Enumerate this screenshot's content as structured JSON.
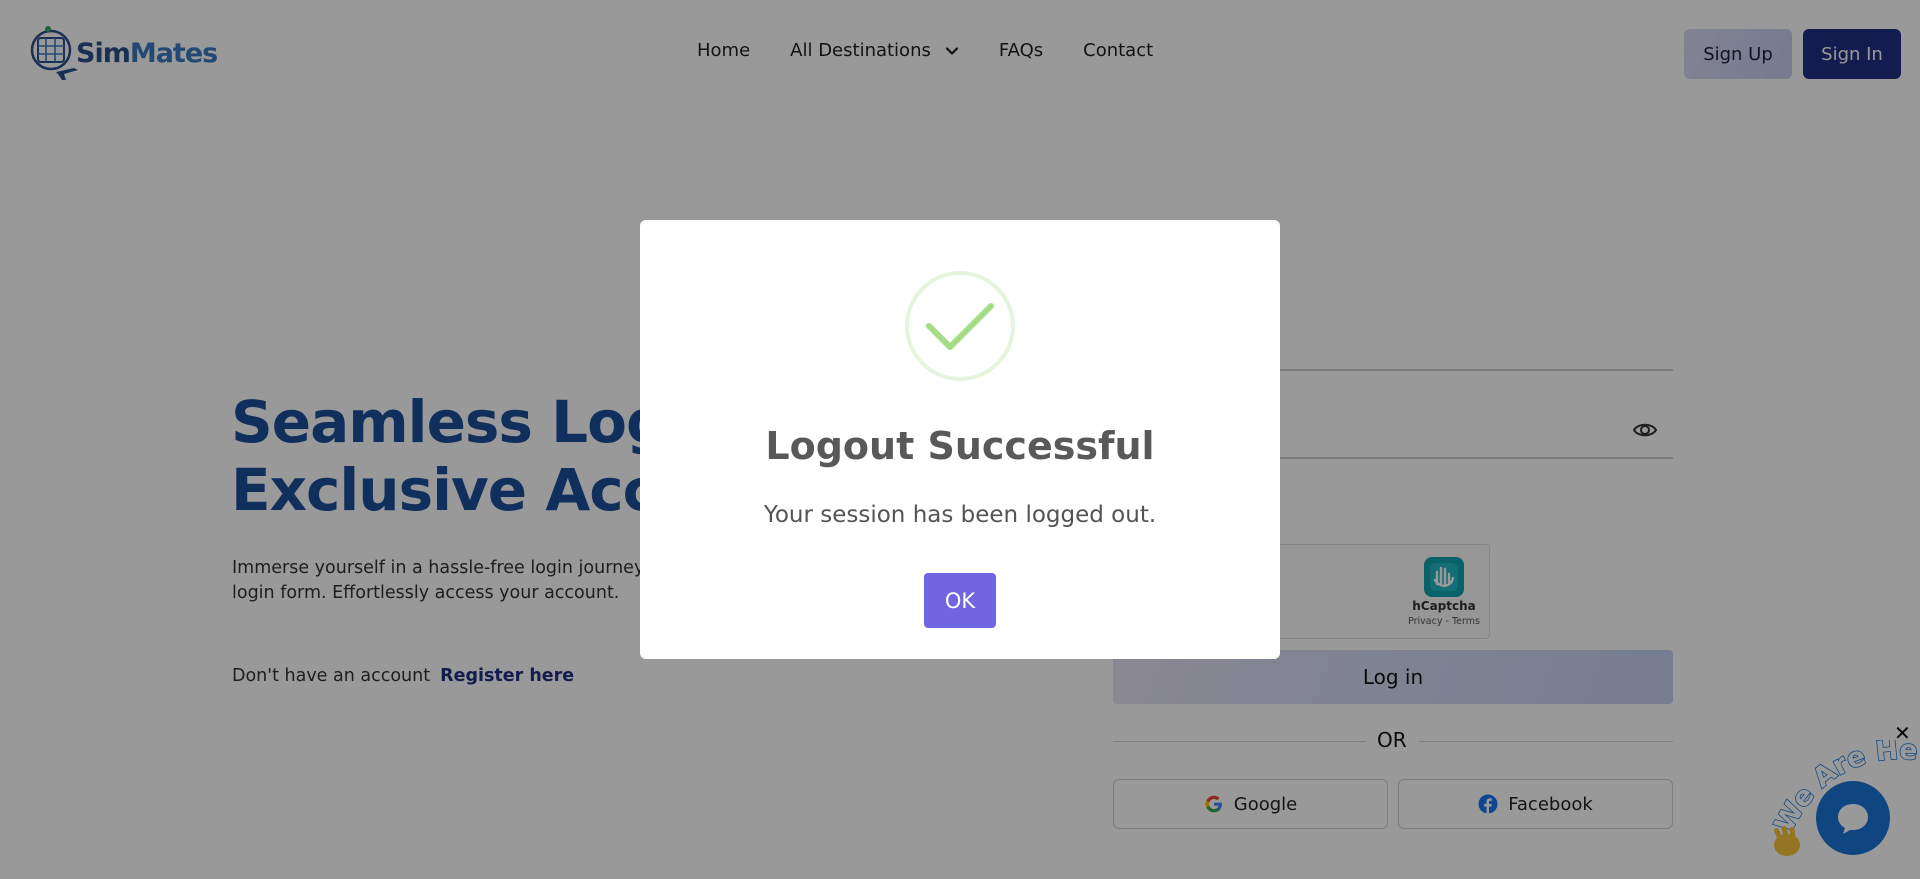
{
  "brand": {
    "name_part1": "Sim",
    "name_part2": "Mates"
  },
  "nav": {
    "items": [
      "Home",
      "All Destinations",
      "FAQs",
      "Contact"
    ]
  },
  "header": {
    "signup_label": "Sign Up",
    "signin_label": "Sign In"
  },
  "hero": {
    "title_line1": "Seamless Login for",
    "title_line2": "Exclusive Access",
    "description": "Immerse yourself in a hassle-free login journey with our intuitively designed login form. Effortlessly access your account.",
    "register_prompt": "Don't have an account",
    "register_link": "Register here"
  },
  "form": {
    "captcha_name": "hCaptcha",
    "captcha_terms": "Privacy - Terms",
    "login_label": "Log in",
    "or_label": "OR",
    "google_label": "Google",
    "facebook_label": "Facebook"
  },
  "chat": {
    "badge_text": "We Are Here!",
    "close_glyph": "✕"
  },
  "modal": {
    "title": "Logout Successful",
    "message": "Your session has been logged out.",
    "ok_label": "OK"
  },
  "colors": {
    "brand_dark": "#1f2f82",
    "hero_title": "#1d4f9a",
    "success_green": "#a5dc86",
    "confirm_button": "#7066e0",
    "chat_blue": "#1a73d6"
  }
}
